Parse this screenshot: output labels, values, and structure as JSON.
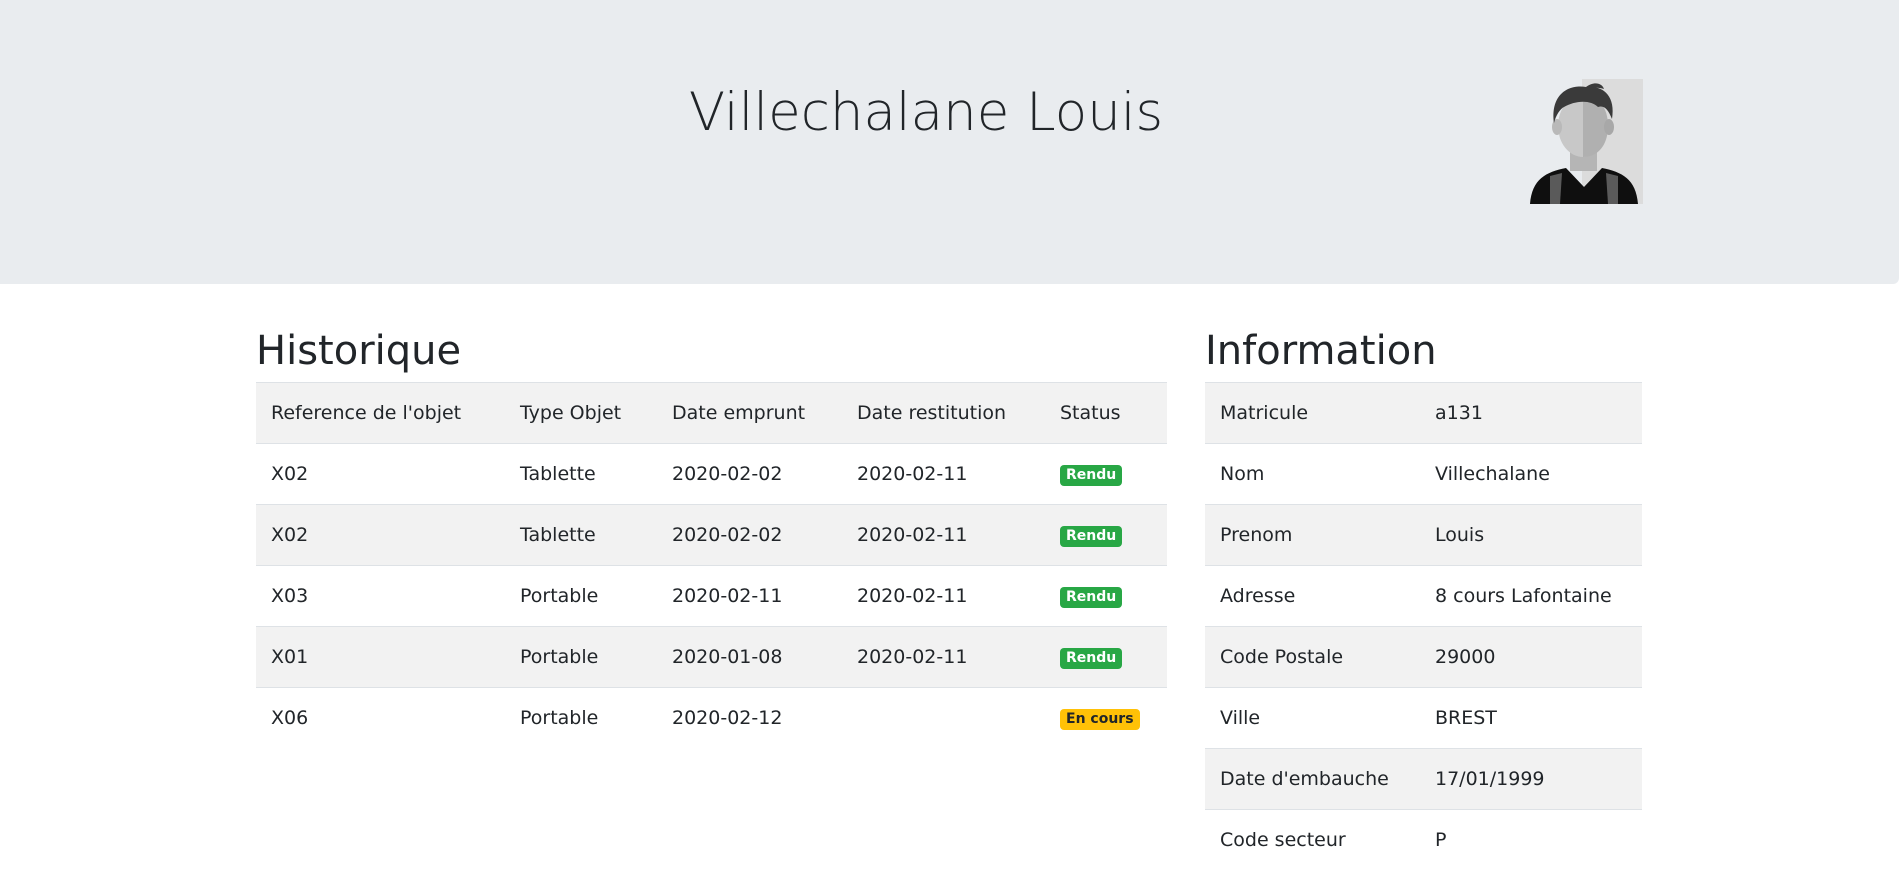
{
  "header": {
    "title": "Villechalane Louis",
    "avatar_icon": "user-avatar-icon"
  },
  "historique": {
    "title": "Historique",
    "columns": [
      "Reference de l'objet",
      "Type Objet",
      "Date emprunt",
      "Date restitution",
      "Status"
    ],
    "rows": [
      {
        "reference": "X02",
        "type": "Tablette",
        "date_emprunt": "2020-02-02",
        "date_restitution": "2020-02-11",
        "status": "Rendu",
        "status_color": "#28a745"
      },
      {
        "reference": "X02",
        "type": "Tablette",
        "date_emprunt": "2020-02-02",
        "date_restitution": "2020-02-11",
        "status": "Rendu",
        "status_color": "#28a745"
      },
      {
        "reference": "X03",
        "type": "Portable",
        "date_emprunt": "2020-02-11",
        "date_restitution": "2020-02-11",
        "status": "Rendu",
        "status_color": "#28a745"
      },
      {
        "reference": "X01",
        "type": "Portable",
        "date_emprunt": "2020-01-08",
        "date_restitution": "2020-02-11",
        "status": "Rendu",
        "status_color": "#28a745"
      },
      {
        "reference": "X06",
        "type": "Portable",
        "date_emprunt": "2020-02-12",
        "date_restitution": "",
        "status": "En cours",
        "status_color": "#ffc107"
      }
    ]
  },
  "information": {
    "title": "Information",
    "rows": [
      {
        "label": "Matricule",
        "value": "a131"
      },
      {
        "label": "Nom",
        "value": "Villechalane"
      },
      {
        "label": "Prenom",
        "value": "Louis"
      },
      {
        "label": "Adresse",
        "value": "8 cours Lafontaine"
      },
      {
        "label": "Code Postale",
        "value": "29000"
      },
      {
        "label": "Ville",
        "value": "BREST"
      },
      {
        "label": "Date d'embauche",
        "value": "17/01/1999"
      },
      {
        "label": "Code secteur",
        "value": "P"
      }
    ]
  },
  "colors": {
    "header_bg": "#e9ecef",
    "stripe": "#f2f2f2",
    "success": "#28a745",
    "warning": "#ffc107"
  }
}
